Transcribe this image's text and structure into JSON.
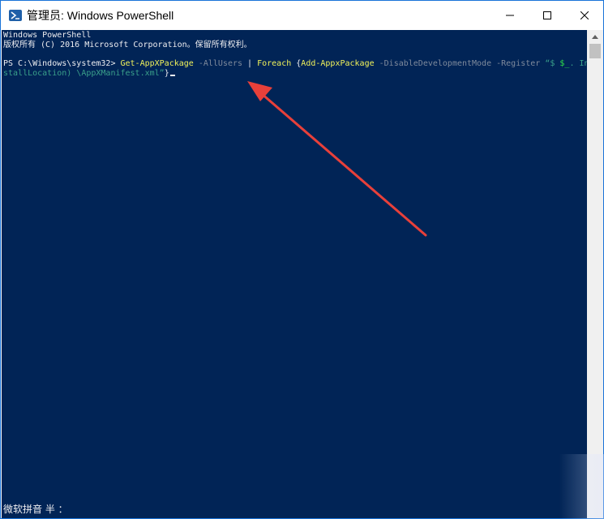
{
  "window": {
    "title": "管理员: Windows PowerShell",
    "icon": "powershell-icon"
  },
  "controls": {
    "minimize": "minimize-icon",
    "maximize": "maximize-icon",
    "close": "close-icon"
  },
  "console": {
    "banner_line1": "Windows PowerShell",
    "banner_line2": "版权所有 (C) 2016 Microsoft Corporation。保留所有权利。",
    "prompt": "PS C:\\Windows\\system32> ",
    "cmd1": "Get-AppXPackage",
    "param1": " -AllUsers ",
    "pipe": "| ",
    "foreach": "Foreach ",
    "brace_open": "{",
    "cmd2": "Add-AppxPackage",
    "param2": " -DisableDevelopmentMode -Register ",
    "str1": "“$ ",
    "var1": "$_",
    "str2": ". In",
    "line2_str": "stallLocation) \\AppXManifest.xml”",
    "brace_close": "}"
  },
  "ime": {
    "status": "微软拼音 半 ："
  },
  "colors": {
    "console_bg": "#012456",
    "console_fg": "#eeedf0",
    "command": "#f2f25a",
    "annotation_arrow": "#e8403a"
  }
}
